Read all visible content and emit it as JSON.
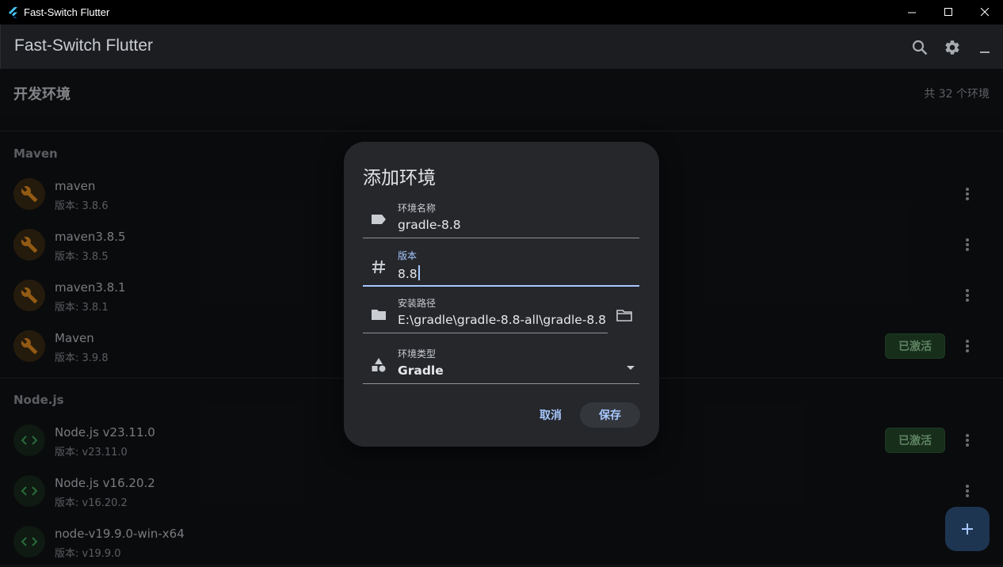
{
  "window": {
    "title": "Fast-Switch Flutter"
  },
  "appbar": {
    "title": "Fast-Switch Flutter"
  },
  "subheader": {
    "title": "开发环境",
    "count": "共 32 个环境"
  },
  "sections": {
    "maven": {
      "title": "Maven",
      "items": [
        {
          "name": "maven",
          "version": "版本: 3.8.6"
        },
        {
          "name": "maven3.8.5",
          "version": "版本: 3.8.5"
        },
        {
          "name": "maven3.8.1",
          "version": "版本: 3.8.1"
        },
        {
          "name": "Maven",
          "version": "版本: 3.9.8",
          "badge": "已激活"
        }
      ]
    },
    "node": {
      "title": "Node.js",
      "items": [
        {
          "name": "Node.js v23.11.0",
          "version": "版本: v23.11.0",
          "badge": "已激活"
        },
        {
          "name": "Node.js v16.20.2",
          "version": "版本: v16.20.2"
        },
        {
          "name": "node-v19.9.0-win-x64",
          "version": "版本: v19.9.0"
        }
      ]
    }
  },
  "dialog": {
    "title": "添加环境",
    "fields": {
      "name": {
        "label": "环境名称",
        "value": "gradle-8.8"
      },
      "version": {
        "label": "版本",
        "value": "8.8"
      },
      "path": {
        "label": "安装路径",
        "value": "E:\\gradle\\gradle-8.8-all\\gradle-8.8"
      },
      "type": {
        "label": "环境类型",
        "value": "Gradle"
      }
    },
    "cancel": "取消",
    "save": "保存"
  },
  "colors": {
    "accent": "#a7c8ff",
    "badge_bg": "#24472a",
    "maven_icon": "#e08a1e",
    "node_icon": "#3fa55a"
  }
}
